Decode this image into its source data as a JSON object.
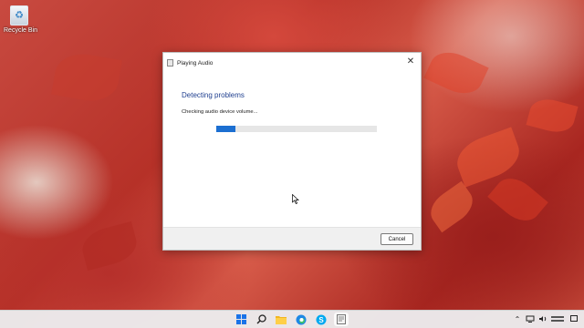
{
  "desktop": {
    "icons": [
      {
        "label": "Recycle Bin",
        "icon": "recycle-bin-icon"
      }
    ]
  },
  "dialog": {
    "title": "Playing Audio",
    "heading": "Detecting problems",
    "status": "Checking audio device volume...",
    "progress": 0.12,
    "cancel_label": "Cancel",
    "accent_color": "#1c6fd1"
  },
  "taskbar": {
    "apps": [
      "windows-start-icon",
      "search-icon",
      "file-explorer-icon",
      "edge-icon",
      "skype-icon",
      "troubleshooter-icon"
    ],
    "tray": [
      "chevron-up-icon",
      "network-icon",
      "volume-icon",
      "notification-icon"
    ]
  }
}
